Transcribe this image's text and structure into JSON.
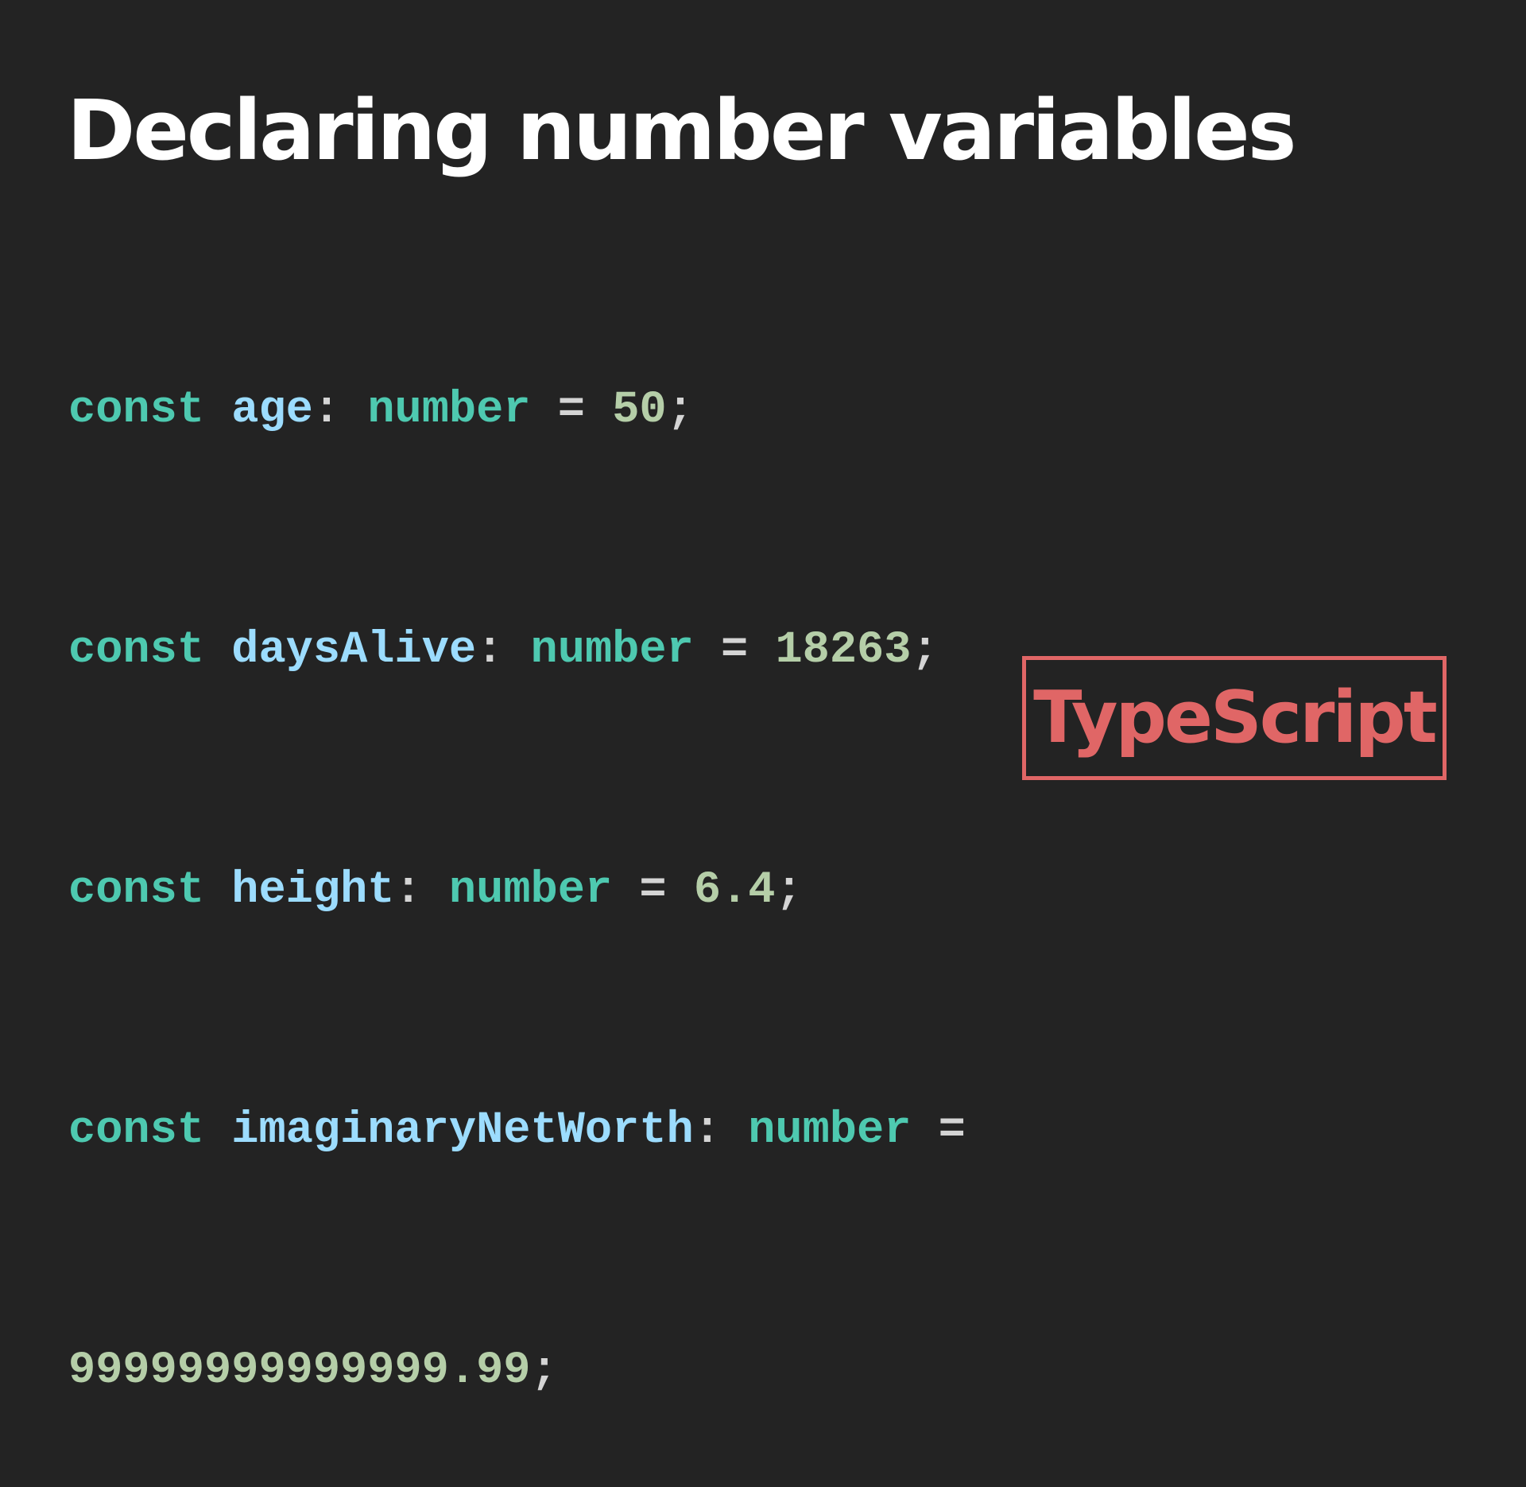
{
  "slide": {
    "title": "Declaring number variables",
    "badge": "TypeScript",
    "colors": {
      "background": "#232323",
      "title": "#ffffff",
      "keyword": "#4ec9b0",
      "identifier": "#9cdcfe",
      "type": "#4ec9b0",
      "punctuation": "#d4d4d4",
      "number": "#b5cea8",
      "badge": "#e06666"
    }
  },
  "code": {
    "lines": [
      {
        "keyword": "const",
        "name": "age",
        "colon": ":",
        "type": "number",
        "equals": "=",
        "value": "50",
        "semicolon": ";"
      },
      {
        "keyword": "const",
        "name": "daysAlive",
        "colon": ":",
        "type": "number",
        "equals": "=",
        "value": "18263",
        "semicolon": ";"
      },
      {
        "keyword": "const",
        "name": "height",
        "colon": ":",
        "type": "number",
        "equals": "=",
        "value": "6.4",
        "semicolon": ";"
      },
      {
        "keyword": "const",
        "name": "imaginaryNetWorth",
        "colon": ":",
        "type": "number",
        "equals": "="
      },
      {
        "value": "99999999999999.99",
        "semicolon": ";"
      }
    ]
  }
}
